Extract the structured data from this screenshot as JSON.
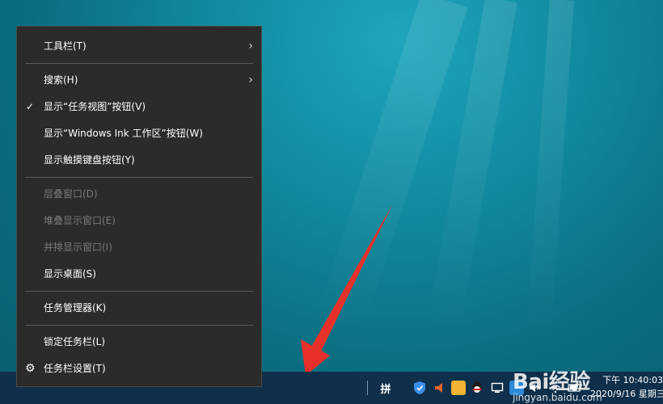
{
  "menu": {
    "items": [
      {
        "label": "工具栏(T)",
        "enabled": true,
        "submenu": true
      },
      {
        "label": "搜索(H)",
        "enabled": true,
        "submenu": true
      },
      {
        "label": "显示“任务视图”按钮(V)",
        "enabled": true,
        "checked": true
      },
      {
        "label": "显示“Windows Ink 工作区”按钮(W)",
        "enabled": true
      },
      {
        "label": "显示触摸键盘按钮(Y)",
        "enabled": true
      },
      {
        "label": "层叠窗口(D)",
        "enabled": false
      },
      {
        "label": "堆叠显示窗口(E)",
        "enabled": false
      },
      {
        "label": "并排显示窗口(I)",
        "enabled": false
      },
      {
        "label": "显示桌面(S)",
        "enabled": true
      },
      {
        "label": "任务管理器(K)",
        "enabled": true
      },
      {
        "label": "锁定任务栏(L)",
        "enabled": true
      },
      {
        "label": "任务栏设置(T)",
        "enabled": true,
        "icon": "gear-icon"
      }
    ]
  },
  "taskbar": {
    "tray": {
      "input_method": "拼",
      "icons": [
        "shield-icon",
        "speaker-icon",
        "sun-app-icon",
        "qq-icon",
        "display-icon",
        "network-icon",
        "mute-icon",
        "wifi-icon",
        "battery-icon"
      ]
    },
    "clock": {
      "time": "下午 10:40:03",
      "date": "2020/9/16 星期三"
    }
  },
  "watermark": {
    "brand": "Bai经验",
    "url": "jingyan.baidu.com"
  },
  "colors": {
    "menu_bg": "#2b2b2b",
    "menu_text": "#ffffff",
    "menu_disabled": "#7a7a7a",
    "annotation_arrow": "#e8302a",
    "taskbar_bg": "#0f2f4a"
  }
}
